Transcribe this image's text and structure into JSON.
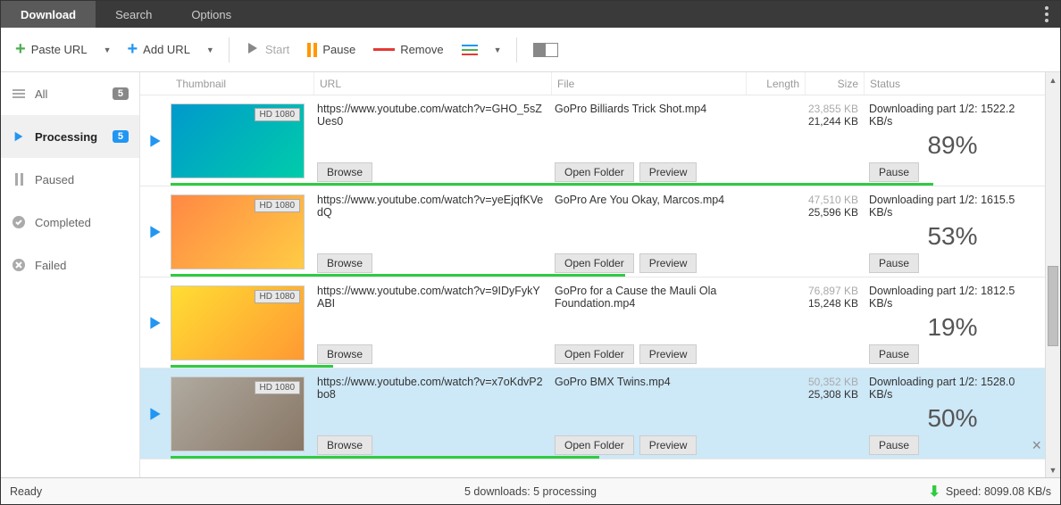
{
  "tabs": {
    "download": "Download",
    "search": "Search",
    "options": "Options"
  },
  "toolbar": {
    "paste_url": "Paste URL",
    "add_url": "Add URL",
    "start": "Start",
    "pause": "Pause",
    "remove": "Remove"
  },
  "sidebar": {
    "all": {
      "label": "All",
      "count": "5"
    },
    "processing": {
      "label": "Processing",
      "count": "5"
    },
    "paused": {
      "label": "Paused"
    },
    "completed": {
      "label": "Completed"
    },
    "failed": {
      "label": "Failed"
    }
  },
  "columns": {
    "thumb": "Thumbnail",
    "url": "URL",
    "file": "File",
    "length": "Length",
    "size": "Size",
    "status": "Status"
  },
  "buttons": {
    "browse": "Browse",
    "open_folder": "Open Folder",
    "preview": "Preview",
    "pause": "Pause"
  },
  "thumb_badge": "HD 1080",
  "rows": [
    {
      "url": "https://www.youtube.com/watch?v=GHO_5sZUes0",
      "file": "GoPro  Billiards Trick Shot.mp4",
      "size_total": "23,855 KB",
      "size_done": "21,244 KB",
      "status_msg": "Downloading part 1/2: 1522.2 KB/s",
      "pct": "89%",
      "progress": 89,
      "selected": false,
      "thumb_class": ""
    },
    {
      "url": "https://www.youtube.com/watch?v=yeEjqfKVedQ",
      "file": "GoPro  Are You Okay, Marcos.mp4",
      "size_total": "47,510 KB",
      "size_done": "25,596 KB",
      "status_msg": "Downloading part 1/2: 1615.5 KB/s",
      "pct": "53%",
      "progress": 53,
      "selected": false,
      "thumb_class": "thumb2"
    },
    {
      "url": "https://www.youtube.com/watch?v=9IDyFykYABI",
      "file": "GoPro for a Cause  the Mauli Ola Foundation.mp4",
      "size_total": "76,897 KB",
      "size_done": "15,248 KB",
      "status_msg": "Downloading part 1/2: 1812.5 KB/s",
      "pct": "19%",
      "progress": 19,
      "selected": false,
      "thumb_class": "thumb3"
    },
    {
      "url": "https://www.youtube.com/watch?v=x7oKdvP2bo8",
      "file": "GoPro  BMX Twins.mp4",
      "size_total": "50,352 KB",
      "size_done": "25,308 KB",
      "status_msg": "Downloading part 1/2: 1528.0 KB/s",
      "pct": "50%",
      "progress": 50,
      "selected": true,
      "thumb_class": "thumb4"
    }
  ],
  "statusbar": {
    "ready": "Ready",
    "mid": "5 downloads: 5 processing",
    "speed": "Speed: 8099.08 KB/s"
  }
}
